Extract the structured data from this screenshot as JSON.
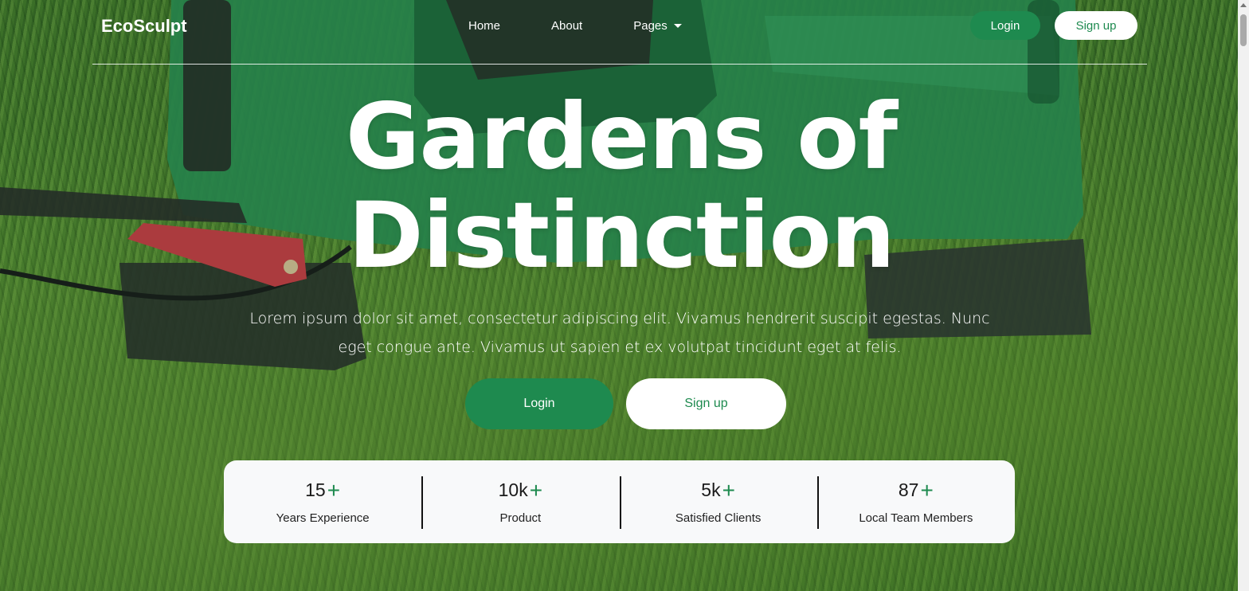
{
  "brand": "EcoSculpt",
  "nav": {
    "links": [
      {
        "label": "Home"
      },
      {
        "label": "About"
      },
      {
        "label": "Pages"
      }
    ],
    "login_label": "Login",
    "signup_label": "Sign up"
  },
  "hero": {
    "title_line1": "Gardens of",
    "title_line2": "Distinction",
    "text": "Lorem ipsum dolor sit amet, consectetur adipiscing elit. Vivamus hendrerit suscipit egestas. Nunc eget congue ante. Vivamus ut sapien et ex volutpat tincidunt eget at felis.",
    "login_label": "Login",
    "signup_label": "Sign up"
  },
  "stats": [
    {
      "value": "15",
      "suffix": "+",
      "label": "Years Experience"
    },
    {
      "value": "10k",
      "suffix": "+",
      "label": "Product"
    },
    {
      "value": "5k",
      "suffix": "+",
      "label": "Satisfied Clients"
    },
    {
      "value": "87",
      "suffix": "+",
      "label": "Local Team Members"
    }
  ],
  "colors": {
    "accent": "#1e8a4f",
    "card_bg": "#f8f9fa",
    "text_light": "#ffffff"
  },
  "icons": {
    "pages_dropdown": "caret-down-icon"
  }
}
